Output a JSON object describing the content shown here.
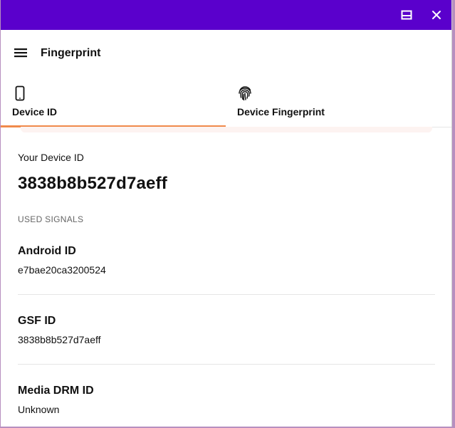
{
  "titlebar": {
    "maximize_icon": "window-maximize-icon",
    "close_icon": "close-icon"
  },
  "appbar": {
    "menu_icon": "hamburger-menu-icon",
    "title": "Fingerprint"
  },
  "tabs": [
    {
      "label": "Device ID",
      "icon": "phone-icon",
      "active": true
    },
    {
      "label": "Device Fingerprint",
      "icon": "fingerprint-icon",
      "active": false
    }
  ],
  "accent_color": "#f08a4b",
  "titlebar_color": "#5a00cc",
  "main": {
    "your_id_label": "Your Device ID",
    "device_id": "3838b8b527d7aeff",
    "signals_label": "USED SIGNALS",
    "signals": [
      {
        "name": "Android ID",
        "value": "e7bae20ca3200524"
      },
      {
        "name": "GSF ID",
        "value": "3838b8b527d7aeff"
      },
      {
        "name": "Media DRM ID",
        "value": "Unknown"
      }
    ]
  }
}
